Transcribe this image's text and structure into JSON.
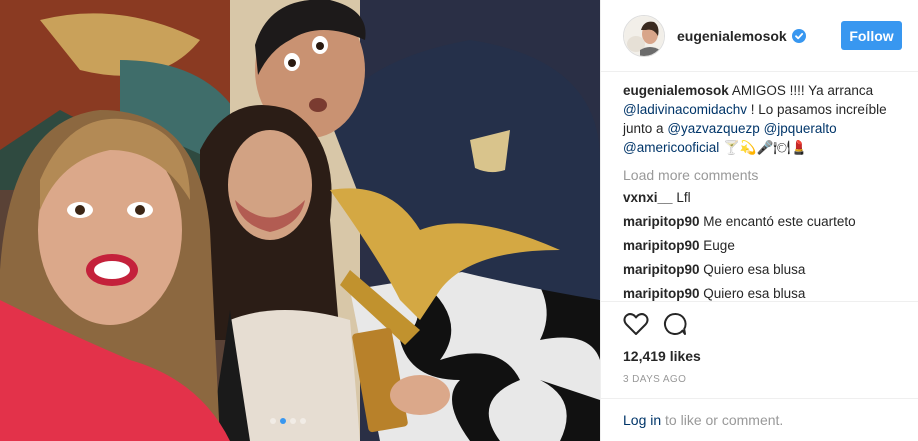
{
  "post": {
    "username": "eugenialemosok",
    "verified": true,
    "follow_label": "Follow",
    "caption": {
      "username": "eugenialemosok",
      "text_1": "AMIGOS !!!! Ya arranca",
      "mention_1": "@ladivinacomidachv",
      "text_2": "! Lo pasamos increíble junto a",
      "mention_2": "@yazvazquezp",
      "mention_3": "@jpqueralto",
      "mention_4": "@americooficial",
      "emojis": "🍸💫🎤🍽💄"
    },
    "load_more_label": "Load more comments",
    "comments": [
      {
        "username": "vxnxi__",
        "text": "Lfl"
      },
      {
        "username": "maripitop90",
        "text": "Me encantó este cuarteto"
      },
      {
        "username": "maripitop90",
        "text": "Euge"
      },
      {
        "username": "maripitop90",
        "text": "Quiero esa blusa"
      },
      {
        "username": "maripitop90",
        "text": "Quiero esa blusa"
      }
    ],
    "likes": "12,419 likes",
    "date": "3 DAYS AGO",
    "login": {
      "link": "Log in",
      "text": "to like or comment."
    }
  },
  "icons": {
    "like": "heart-icon",
    "comment": "comment-bubble-icon",
    "verified": "verified-badge-icon"
  },
  "colors": {
    "accent": "#3897f0",
    "mention": "#003569",
    "muted": "#999999"
  }
}
